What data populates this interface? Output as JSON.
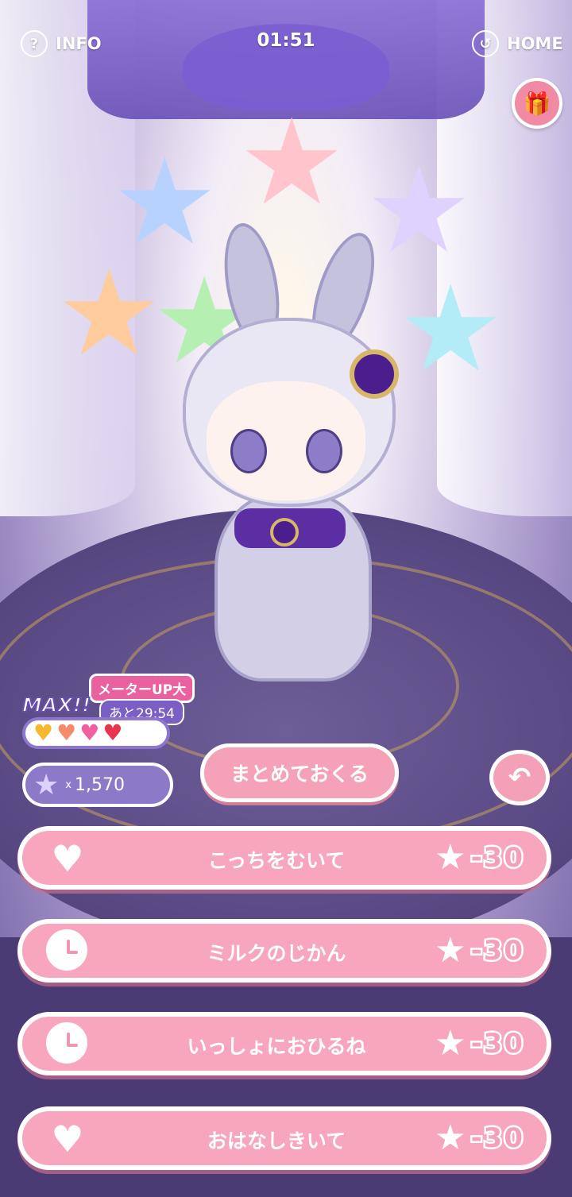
{
  "header": {
    "info_label": "INFO",
    "info_icon": "question-icon",
    "timer": "01:51",
    "home_label": "HOME",
    "home_icon": "back-arrow-icon",
    "gift_icon": "gift-box-icon"
  },
  "status": {
    "meter_up": "メーターUP大",
    "max_label": "MAX!!",
    "remaining": "あと29:54",
    "hearts": [
      "yellow",
      "orange",
      "pink",
      "red"
    ],
    "stars_prefix": "x",
    "stars_count": "1,570"
  },
  "controls": {
    "send_all_label": "まとめておくる",
    "back_icon": "undo-icon"
  },
  "actions": [
    {
      "label": "こっちをむいて",
      "icon": "heart-icon",
      "cost": "-30"
    },
    {
      "label": "ミルクのじかん",
      "icon": "clock-icon",
      "cost": "-30"
    },
    {
      "label": "いっしょにおひるね",
      "icon": "clock-icon",
      "cost": "-30"
    },
    {
      "label": "おはなしきいて",
      "icon": "heart-icon",
      "cost": "-30"
    }
  ],
  "colors": {
    "pink_button": "#f8a6bd",
    "purple_floor": "#5b4b86",
    "accent_purple": "#8c7ac8"
  }
}
